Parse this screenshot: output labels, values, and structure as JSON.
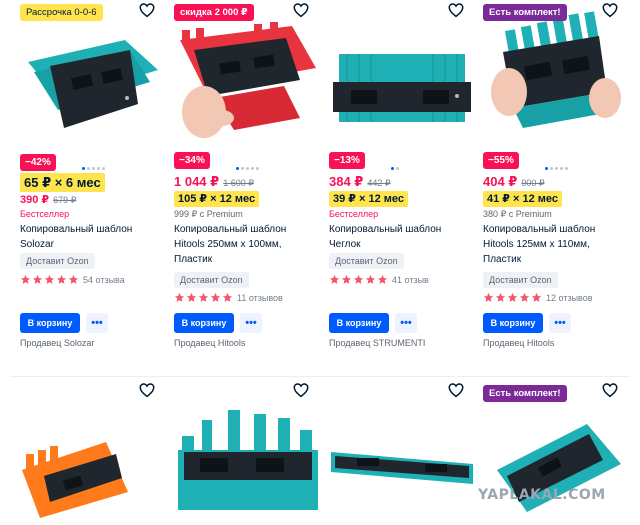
{
  "colors": {
    "accent_blue": "#005bff",
    "discount_pink": "#f91155",
    "installment_yellow": "#ffe44d",
    "promo_purple": "#7c2a9a",
    "product_teal": "#1fb0b5"
  },
  "products": [
    {
      "pill": "Рассрочка 0-0-6",
      "discount": "",
      "installment_big": "65 ₽ × 6 мес",
      "price": "390 ₽",
      "old_price": "679 ₽",
      "sub": "Бестселлер",
      "title": "Копировальный шаблон Solozar",
      "shipping": "Доставит Ozon",
      "rating": 5,
      "reviews": "54 отзыва",
      "cart": "В корзину",
      "more": "•••",
      "seller": "Продавец Solozar"
    },
    {
      "pill": "скидка 2 000 ₽",
      "discount": "−34%",
      "price": "1 044 ₽",
      "old_price": "1 600 ₽",
      "installment": "105 ₽ × 12 мес",
      "sub": "999 ₽ с Premium",
      "title": "Копировальный шаблон Hitools 250мм х 100мм, Пластик",
      "shipping": "Доставит Ozon",
      "rating": 5,
      "reviews": "11 отзывов",
      "cart": "В корзину",
      "more": "•••",
      "seller": "Продавец Hitools"
    },
    {
      "pill": "",
      "discount": "−13%",
      "price": "384 ₽",
      "old_price": "442 ₽",
      "installment": "39 ₽ × 12 мес",
      "sub": "Бестселлер",
      "title": "Копировальный шаблон Чеглок",
      "shipping": "Доставит Ozon",
      "rating": 5,
      "reviews": "41 отзыв",
      "cart": "В корзину",
      "more": "•••",
      "seller": "Продавец STRUMENTI"
    },
    {
      "pill": "Есть комплект!",
      "discount": "−55%",
      "price": "404 ₽",
      "old_price": "900 ₽",
      "installment": "41 ₽ × 12 мес",
      "sub": "380 ₽ с Premium",
      "title": "Копировальный шаблон Hitools 125мм х 110мм, Пластик",
      "shipping": "Доставит Ozon",
      "rating": 5,
      "reviews": "12 отзывов",
      "cart": "В корзину",
      "more": "•••",
      "seller": "Продавец Hitools"
    }
  ],
  "row2": [
    {
      "pill": ""
    },
    {
      "pill": ""
    },
    {
      "pill": ""
    },
    {
      "pill": "Есть комплект!"
    }
  ],
  "icons": {
    "favorite": "heart-outline-icon",
    "star": "star-icon"
  },
  "watermark": "YAPLAKAL.COM"
}
